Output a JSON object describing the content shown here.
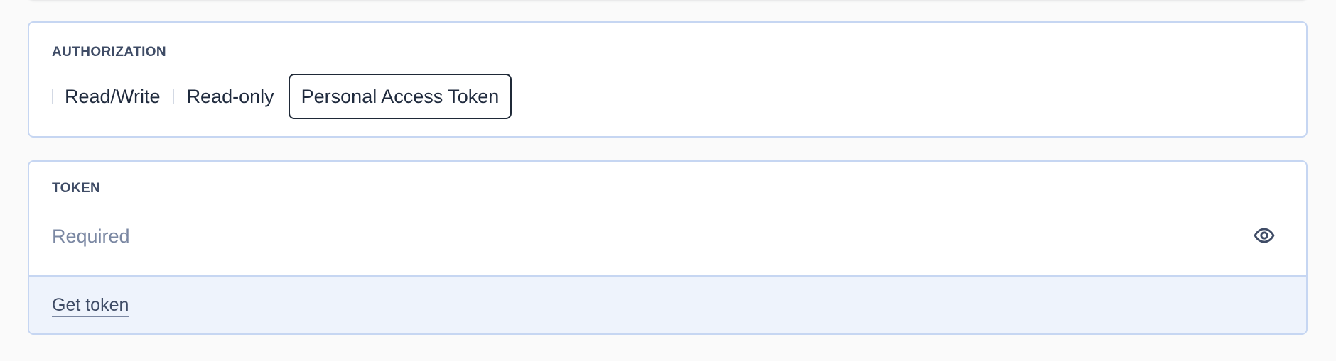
{
  "authorization": {
    "label": "AUTHORIZATION",
    "options": [
      {
        "label": "Read/Write",
        "selected": false
      },
      {
        "label": "Read-only",
        "selected": false
      },
      {
        "label": "Personal Access Token",
        "selected": true
      }
    ]
  },
  "token": {
    "label": "TOKEN",
    "value": "",
    "placeholder": "Required",
    "visibility_icon": "eye-icon",
    "get_token_label": "Get token"
  },
  "colors": {
    "card_border": "#c6d6f2",
    "footer_background": "#eef3fc",
    "label_text": "#3f4c66",
    "placeholder_text": "#7b88a3",
    "selected_border": "#1f2937"
  }
}
